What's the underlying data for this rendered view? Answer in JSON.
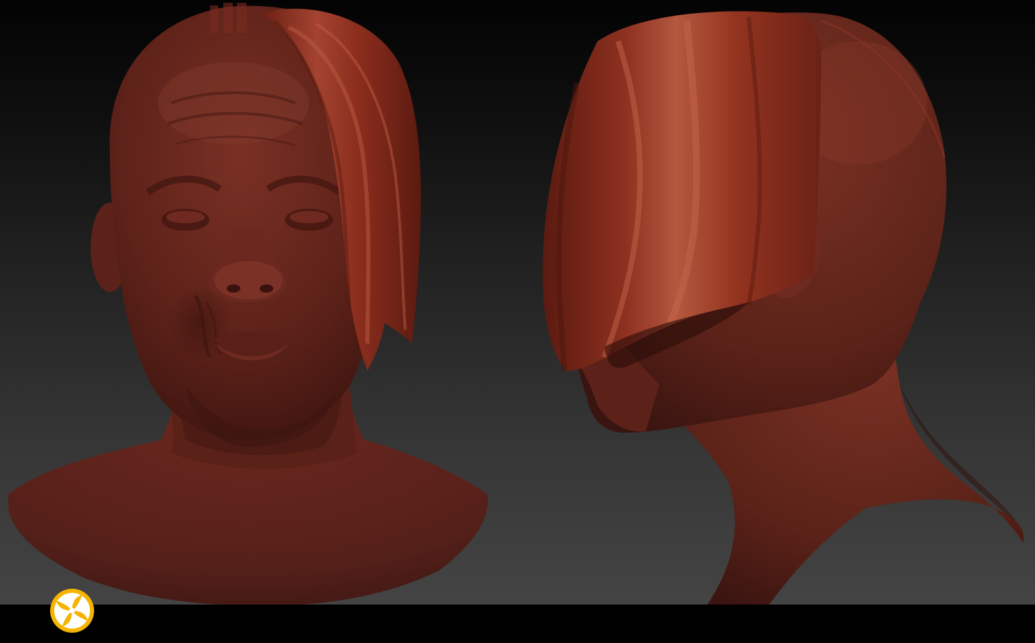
{
  "viewport": {
    "content": "3d-sculpt-render",
    "views": [
      "front-view",
      "side-view"
    ]
  },
  "colors": {
    "background_top": "#030303",
    "background_bottom": "#444444",
    "skin": "#6e2a20",
    "skin_highlight": "#8e3b2c",
    "hair": "#8a2c1c",
    "hair_highlight": "#b4523a",
    "bottom_bar": "#000000",
    "logo_primary": "#f5b400",
    "logo_secondary": "#ffffff"
  },
  "logo": {
    "icon": "pinwheel-logo-icon"
  }
}
